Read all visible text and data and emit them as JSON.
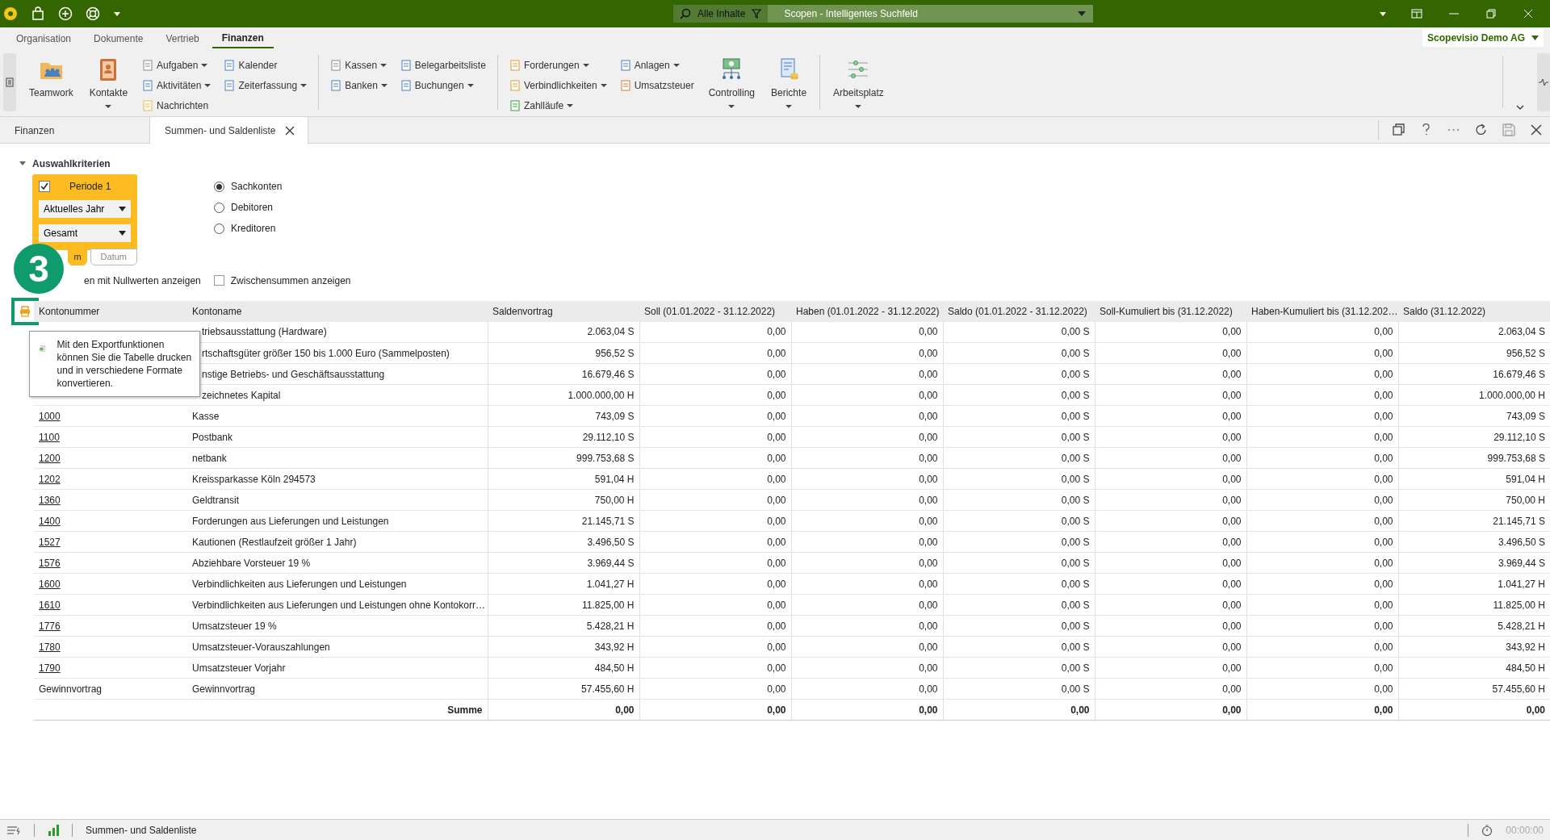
{
  "titlebar": {
    "search_scope": "Alle Inhalte",
    "search_placeholder": "Scopen - Intelligentes Suchfeld"
  },
  "menu_tabs": [
    {
      "label": "Organisation",
      "selected": false
    },
    {
      "label": "Dokumente",
      "selected": false
    },
    {
      "label": "Vertrieb",
      "selected": false
    },
    {
      "label": "Finanzen",
      "selected": true
    }
  ],
  "company": "Scopevisio Demo AG",
  "ribbon": [
    {
      "items": [
        {
          "kind": "large",
          "label": "Teamwork",
          "dropdown": false
        },
        {
          "kind": "large",
          "label": "Kontakte",
          "dropdown": true
        },
        {
          "kind": "stack",
          "buttons": [
            {
              "label": "Aufgaben",
              "dropdown": true
            },
            {
              "label": "Aktivitäten",
              "dropdown": true
            },
            {
              "label": "Nachrichten",
              "dropdown": false
            }
          ]
        },
        {
          "kind": "stack",
          "buttons": [
            {
              "label": "Kalender",
              "dropdown": false
            },
            {
              "label": "Zeiterfassung",
              "dropdown": true
            }
          ]
        }
      ]
    },
    {
      "items": [
        {
          "kind": "stack",
          "buttons": [
            {
              "label": "Kassen",
              "dropdown": true
            },
            {
              "label": "Banken",
              "dropdown": true
            }
          ]
        },
        {
          "kind": "stack",
          "buttons": [
            {
              "label": "Belegarbeitsliste",
              "dropdown": false
            },
            {
              "label": "Buchungen",
              "dropdown": true
            }
          ]
        }
      ]
    },
    {
      "items": [
        {
          "kind": "stack",
          "buttons": [
            {
              "label": "Forderungen",
              "dropdown": true
            },
            {
              "label": "Verbindlichkeiten",
              "dropdown": true
            },
            {
              "label": "Zahlläufe",
              "dropdown": true
            }
          ]
        },
        {
          "kind": "stack",
          "buttons": [
            {
              "label": "Anlagen",
              "dropdown": true
            },
            {
              "label": "Umsatzsteuer",
              "dropdown": false
            }
          ]
        },
        {
          "kind": "large",
          "label": "Controlling",
          "dropdown": true
        },
        {
          "kind": "large",
          "label": "Berichte",
          "dropdown": true
        }
      ]
    },
    {
      "items": [
        {
          "kind": "large",
          "label": "Arbeitsplatz",
          "dropdown": true
        }
      ]
    }
  ],
  "doc_tabs": [
    {
      "label": "Finanzen",
      "selected": false,
      "closable": false
    },
    {
      "label": "Summen- und Saldenliste",
      "selected": true,
      "closable": true
    }
  ],
  "criteria": {
    "title": "Auswahlkriterien",
    "expanded": true,
    "period": {
      "label": "Periode 1",
      "checked": true,
      "selects": [
        "Aktuelles Jahr",
        "Gesamt"
      ],
      "tabs": [
        {
          "label": "m",
          "selected": true
        },
        {
          "label": "Datum",
          "selected": false
        }
      ]
    },
    "account_types": [
      {
        "label": "Sachkonten",
        "selected": true
      },
      {
        "label": "Debitoren",
        "selected": false
      },
      {
        "label": "Kreditoren",
        "selected": false
      }
    ],
    "options": [
      {
        "label": "en mit Nullwerten anzeigen"
      },
      {
        "label": "Zwischensummen anzeigen",
        "checked": false
      }
    ]
  },
  "step_badge": "3",
  "tooltip": {
    "text": "Mit den Exportfunktionen können Sie die Tabelle drucken und in verschiedene Formate konvertieren."
  },
  "table": {
    "columns": [
      "Kontonummer",
      "Kontoname",
      "Saldenvortrag",
      "Soll (01.01.2022 - 31.12.2022)",
      "Haben (01.01.2022 - 31.12.2022)",
      "Saldo (01.01.2022 - 31.12.2022)",
      "Soll-Kumuliert bis (31.12.2022)",
      "Haben-Kumuliert bis (31.12.202…",
      "Saldo (31.12.2022)"
    ],
    "rows": [
      {
        "name": "triebsausstattung (Hardware)",
        "values": [
          "2.063,04 S",
          "0,00",
          "0,00",
          "0,00 S",
          "0,00",
          "0,00",
          "2.063,04 S"
        ]
      },
      {
        "name": "rtschaftsgüter größer 150 bis 1.000 Euro (Sammelposten)",
        "values": [
          "956,52 S",
          "0,00",
          "0,00",
          "0,00 S",
          "0,00",
          "0,00",
          "956,52 S"
        ]
      },
      {
        "name": "nstige Betriebs- und Geschäftsausstattung",
        "values": [
          "16.679,46 S",
          "0,00",
          "0,00",
          "0,00 S",
          "0,00",
          "0,00",
          "16.679,46 S"
        ]
      },
      {
        "name": "zeichnetes Kapital",
        "values": [
          "1.000.000,00 H",
          "0,00",
          "0,00",
          "0,00 S",
          "0,00",
          "0,00",
          "1.000.000,00 H"
        ]
      },
      {
        "number": "1000",
        "link": true,
        "name": "Kasse",
        "values": [
          "743,09 S",
          "0,00",
          "0,00",
          "0,00 S",
          "0,00",
          "0,00",
          "743,09 S"
        ]
      },
      {
        "number": "1100",
        "link": true,
        "name": "Postbank",
        "values": [
          "29.112,10 S",
          "0,00",
          "0,00",
          "0,00 S",
          "0,00",
          "0,00",
          "29.112,10 S"
        ]
      },
      {
        "number": "1200",
        "link": true,
        "name": "netbank",
        "values": [
          "999.753,68 S",
          "0,00",
          "0,00",
          "0,00 S",
          "0,00",
          "0,00",
          "999.753,68 S"
        ]
      },
      {
        "number": "1202",
        "link": true,
        "name": "Kreissparkasse Köln 294573",
        "values": [
          "591,04 H",
          "0,00",
          "0,00",
          "0,00 S",
          "0,00",
          "0,00",
          "591,04 H"
        ]
      },
      {
        "number": "1360",
        "link": true,
        "name": "Geldtransit",
        "values": [
          "750,00 H",
          "0,00",
          "0,00",
          "0,00 S",
          "0,00",
          "0,00",
          "750,00 H"
        ]
      },
      {
        "number": "1400",
        "link": true,
        "name": "Forderungen aus Lieferungen und Leistungen",
        "values": [
          "21.145,71 S",
          "0,00",
          "0,00",
          "0,00 S",
          "0,00",
          "0,00",
          "21.145,71 S"
        ]
      },
      {
        "number": "1527",
        "link": true,
        "name": "Kautionen (Restlaufzeit größer 1 Jahr)",
        "values": [
          "3.496,50 S",
          "0,00",
          "0,00",
          "0,00 S",
          "0,00",
          "0,00",
          "3.496,50 S"
        ]
      },
      {
        "number": "1576",
        "link": true,
        "name": "Abziehbare Vorsteuer 19 %",
        "values": [
          "3.969,44 S",
          "0,00",
          "0,00",
          "0,00 S",
          "0,00",
          "0,00",
          "3.969,44 S"
        ]
      },
      {
        "number": "1600",
        "link": true,
        "name": "Verbindlichkeiten aus Lieferungen und Leistungen",
        "values": [
          "1.041,27 H",
          "0,00",
          "0,00",
          "0,00 S",
          "0,00",
          "0,00",
          "1.041,27 H"
        ]
      },
      {
        "number": "1610",
        "link": true,
        "name": "Verbindlichkeiten aus Lieferungen und Leistungen ohne Kontokorr…",
        "values": [
          "11.825,00 H",
          "0,00",
          "0,00",
          "0,00 S",
          "0,00",
          "0,00",
          "11.825,00 H"
        ]
      },
      {
        "number": "1776",
        "link": true,
        "name": "Umsatzsteuer 19 %",
        "values": [
          "5.428,21 H",
          "0,00",
          "0,00",
          "0,00 S",
          "0,00",
          "0,00",
          "5.428,21 H"
        ]
      },
      {
        "number": "1780",
        "link": true,
        "name": "Umsatzsteuer-Vorauszahlungen",
        "values": [
          "343,92 H",
          "0,00",
          "0,00",
          "0,00 S",
          "0,00",
          "0,00",
          "343,92 H"
        ]
      },
      {
        "number": "1790",
        "link": true,
        "name": "Umsatzsteuer Vorjahr",
        "values": [
          "484,50 H",
          "0,00",
          "0,00",
          "0,00 S",
          "0,00",
          "0,00",
          "484,50 H"
        ]
      },
      {
        "number": "Gewinnvortrag",
        "link": false,
        "name": "Gewinnvortrag",
        "values": [
          "57.455,60 H",
          "0,00",
          "0,00",
          "0,00 S",
          "0,00",
          "0,00",
          "57.455,60 H"
        ]
      }
    ],
    "total": {
      "label": "Summe",
      "values": [
        "0,00",
        "0,00",
        "0,00",
        "0,00",
        "0,00",
        "0,00",
        "0,00"
      ]
    }
  },
  "status_bar": {
    "text": "Summen- und Saldenliste",
    "time": "00:00:00"
  }
}
